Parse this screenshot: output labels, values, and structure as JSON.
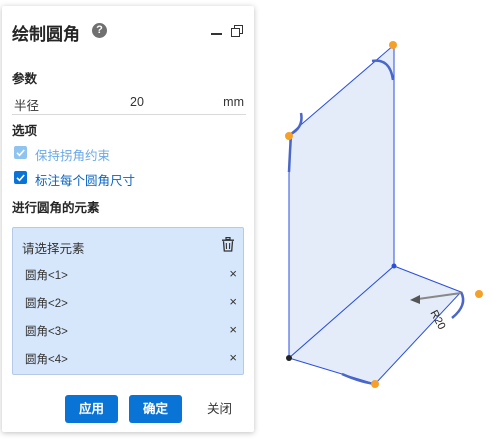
{
  "panel": {
    "title": "绘制圆角",
    "help_icon": "?"
  },
  "params": {
    "section": "参数",
    "radius_label": "半径",
    "radius_value": "20",
    "radius_unit": "mm"
  },
  "options": {
    "section": "选项",
    "keep_corner": {
      "label": "保持拐角约束",
      "checked": true,
      "disabled": true
    },
    "annotate": {
      "label": "标注每个圆角尺寸",
      "checked": true,
      "disabled": false
    }
  },
  "elements": {
    "section": "进行圆角的元素",
    "list_title": "请选择元素",
    "items": [
      "圆角<1>",
      "圆角<2>",
      "圆角<3>",
      "圆角<4>"
    ],
    "remove_glyph": "×"
  },
  "buttons": {
    "apply": "应用",
    "confirm": "确定",
    "close": "关闭"
  },
  "model": {
    "dimension_label": "R20"
  },
  "colors": {
    "accent": "#0a74d6",
    "face_fill": "#e4ecfa",
    "edge": "#2a4fe0",
    "fillet_arc": "#4a66c8",
    "vertex": "#f5a028"
  }
}
